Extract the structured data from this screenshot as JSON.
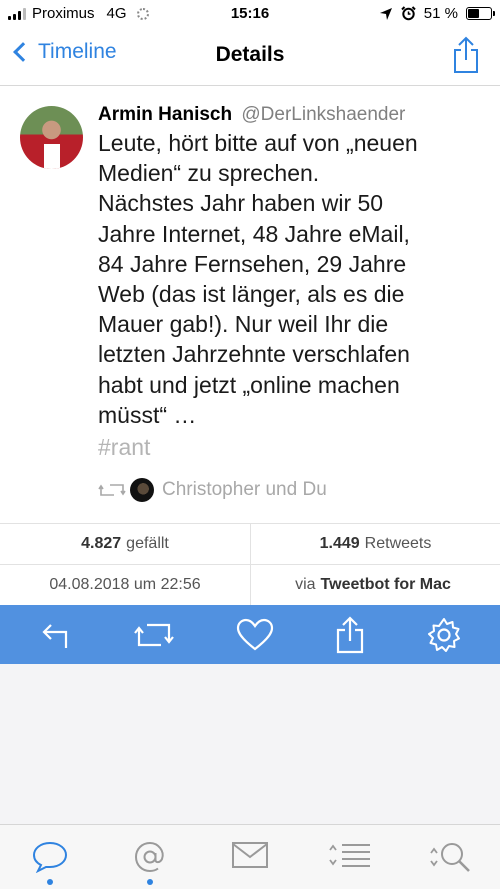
{
  "status_bar": {
    "carrier": "Proximus",
    "network": "4G",
    "time": "15:16",
    "battery_text": "51 %",
    "battery_level": 0.51
  },
  "nav": {
    "back_label": "Timeline",
    "title": "Details"
  },
  "tweet": {
    "author_name": "Armin Hanisch",
    "author_handle": "@DerLinkshaender",
    "text_lines": [
      "Leute, hört bitte auf von „neuen",
      "Medien“ zu sprechen.",
      "Nächstes Jahr haben wir 50",
      "Jahre Internet, 48 Jahre eMail,",
      "84 Jahre Fernsehen, 29 Jahre",
      "Web (das ist länger, als es die",
      "Mauer gab!). Nur weil Ihr die",
      "letzten Jahrzehnte verschlafen",
      "habt und jetzt „online machen",
      "müsst“ …"
    ],
    "hashtag": "#rant",
    "retweeted_by": "Christopher und Du"
  },
  "stats": {
    "likes_count": "4.827",
    "likes_label": "gefällt",
    "retweets_count": "1.449",
    "retweets_label": "Retweets",
    "date": "04.08.2018 um 22:56",
    "via_prefix": "via",
    "client": "Tweetbot for Mac"
  },
  "actions": [
    "reply-icon",
    "retweet-icon",
    "heart-icon",
    "share-icon",
    "gear-icon"
  ],
  "tab_bar": {
    "tabs": [
      "timeline-bubble-icon",
      "mentions-at-icon",
      "messages-envelope-icon",
      "lists-icon",
      "search-icon"
    ],
    "unread_dots": [
      "timeline",
      "mentions"
    ]
  },
  "colors": {
    "accent": "#2f83e0",
    "action_bar": "#5191e0",
    "hashtag": "#b4b4b4"
  }
}
